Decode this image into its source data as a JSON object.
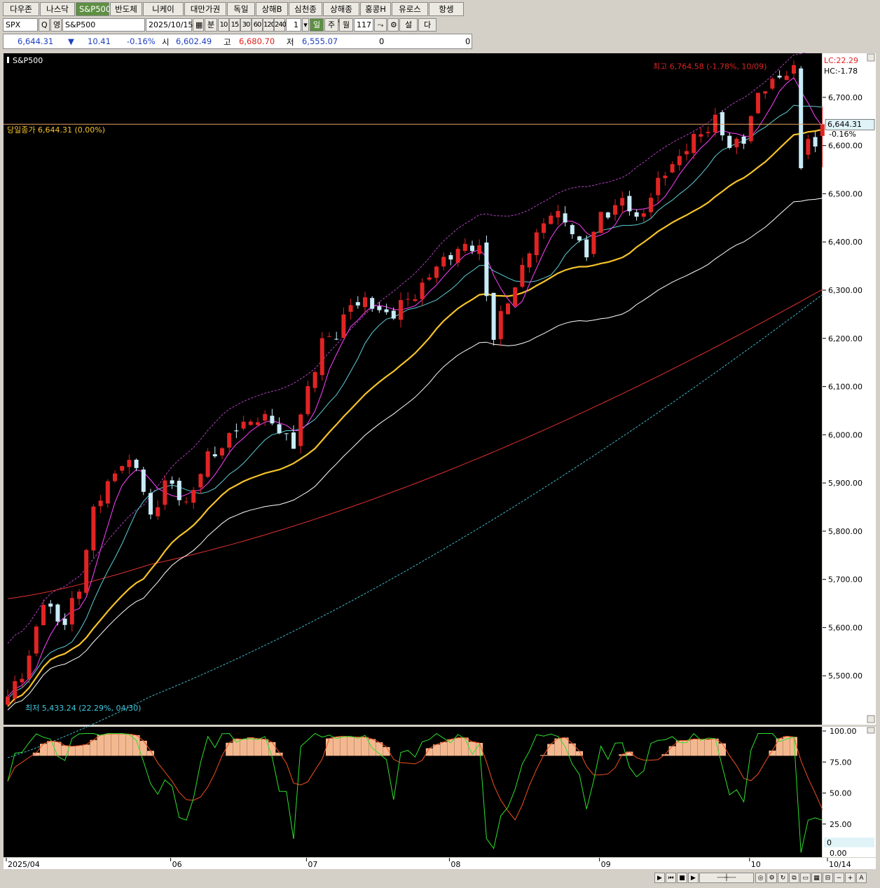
{
  "tabs": [
    "다우존스",
    "나스닥",
    "S&P500",
    "반도체",
    "니케이",
    "대만가권",
    "독일",
    "상해B",
    "심천종합",
    "상해종합",
    "홍콩H",
    "유로스톡",
    "항셍"
  ],
  "active_tab": 2,
  "toolbar": {
    "symbol_code": "SPX",
    "search_icon_label": "Q",
    "lang_label": "영",
    "symbol_name": "S&P500",
    "date": "2025/10/15",
    "unit_label": "분",
    "periods": [
      "10",
      "15",
      "30",
      "60",
      "120",
      "240"
    ],
    "count_value": "1",
    "day_label": "일",
    "week_label": "주",
    "month_label": "월",
    "bar_count": "117",
    "settings_label": "설정",
    "next_label": "다음"
  },
  "quote": {
    "price": "6,644.31",
    "arrow": "▼",
    "change": "10.41",
    "change_pct": "-0.16%",
    "open_label": "시",
    "open": "6,602.49",
    "high_label": "고",
    "high": "6,680.70",
    "low_label": "저",
    "low": "6,555.07",
    "vol1": "0",
    "vol2": "0"
  },
  "colors": {
    "up": "#e02424",
    "down": "#c8ecf8",
    "ma5": "#ff40ff",
    "ma10": "#5fcfd6",
    "ma20": "#f5c22a",
    "ma60": "#ffffff",
    "ma120": "#e03030",
    "band": "#b040c0",
    "band_low": "#40b8c8",
    "stoch_k": "#2de02d",
    "stoch_d": "#f05020",
    "stoch_fill": "#f4b890",
    "close_line": "#e8a060"
  },
  "chart_data": {
    "type": "candlestick",
    "title": "S&P500",
    "date_labels": [
      "2025/04",
      "06",
      "07",
      "08",
      "09",
      "10",
      "10/14"
    ],
    "yticks": [
      5500,
      5600,
      5700,
      5800,
      5900,
      6000,
      6100,
      6200,
      6300,
      6400,
      6500,
      6600,
      6700
    ],
    "ylim": [
      5400,
      6790
    ],
    "lc_label": "LC:22.29",
    "hc_label": "HC:-1.78",
    "last_close_label": "당일종가 6,644.31 (0.00%)",
    "last_price_tag": "6,644.31",
    "last_pct_tag": "-0.16%",
    "high_note": "최고 6,764.58 (-1.78%, 10/09)",
    "low_note": "최저 5,433.24 (22.29%, 04/30)",
    "anchors": [
      [
        0,
        5450
      ],
      [
        3,
        5540
      ],
      [
        5,
        5650
      ],
      [
        8,
        5610
      ],
      [
        10,
        5680
      ],
      [
        12,
        5850
      ],
      [
        14,
        5890
      ],
      [
        16,
        5950
      ],
      [
        18,
        5930
      ],
      [
        20,
        5830
      ],
      [
        22,
        5900
      ],
      [
        25,
        5860
      ],
      [
        28,
        5950
      ],
      [
        32,
        6010
      ],
      [
        35,
        6040
      ],
      [
        39,
        6000
      ],
      [
        40,
        5980
      ],
      [
        42,
        6090
      ],
      [
        44,
        6200
      ],
      [
        46,
        6200
      ],
      [
        48,
        6280
      ],
      [
        50,
        6270
      ],
      [
        54,
        6250
      ],
      [
        58,
        6310
      ],
      [
        62,
        6380
      ],
      [
        66,
        6390
      ],
      [
        68,
        6200
      ],
      [
        70,
        6280
      ],
      [
        73,
        6380
      ],
      [
        76,
        6470
      ],
      [
        79,
        6420
      ],
      [
        81,
        6380
      ],
      [
        83,
        6450
      ],
      [
        86,
        6490
      ],
      [
        88,
        6440
      ],
      [
        90,
        6500
      ],
      [
        93,
        6560
      ],
      [
        95,
        6600
      ],
      [
        97,
        6620
      ],
      [
        99,
        6660
      ],
      [
        101,
        6590
      ],
      [
        103,
        6620
      ],
      [
        105,
        6700
      ],
      [
        108,
        6750
      ],
      [
        110,
        6750
      ],
      [
        111,
        6580
      ],
      [
        112,
        6620
      ],
      [
        113,
        6595
      ],
      [
        114,
        6644
      ]
    ],
    "stoch_yticks": [
      "100.00",
      "75.00",
      "50.00",
      "25.00",
      "0.00"
    ],
    "stoch_k_label": "0"
  },
  "scroll": {
    "play_label": "▶",
    "first_label": "⏮",
    "stop_label": "■",
    "last_label": "▶",
    "minus_label": "−",
    "plus_label": "+",
    "font_label": "A"
  }
}
